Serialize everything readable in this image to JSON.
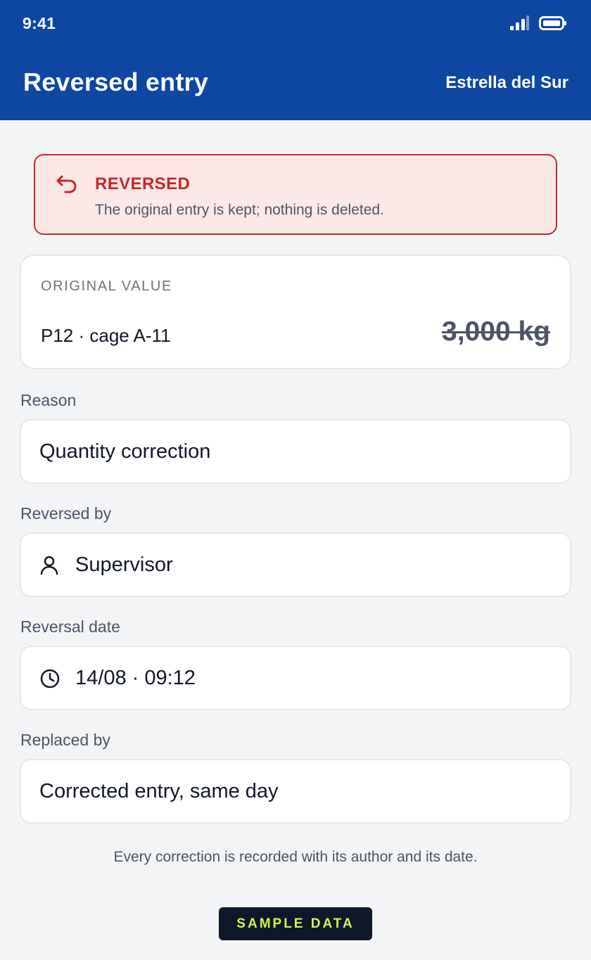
{
  "status_bar": {
    "time": "9:41",
    "icons": [
      "signal-icon",
      "battery-icon"
    ]
  },
  "header": {
    "title": "Reversed entry",
    "organization": "Estrella del Sur",
    "background_color": "#0d47a1"
  },
  "banner": {
    "icon": "undo-icon",
    "title": "REVERSED",
    "text": "The original entry is kept; nothing is deleted.",
    "accent_color": "#c62828"
  },
  "original": {
    "label": "ORIGINAL VALUE",
    "item": "P12 · cage A-11",
    "quantity": "3,000 kg"
  },
  "fields": {
    "reason": {
      "label": "Reason",
      "value": "Quantity correction"
    },
    "reversed_by": {
      "label": "Reversed by",
      "value": "Supervisor",
      "icon": "user-icon"
    },
    "reversal_date": {
      "label": "Reversal date",
      "value": "14/08 · 09:12",
      "icon": "clock-icon"
    },
    "replaced_by": {
      "label": "Replaced by",
      "value": "Corrected entry, same day"
    }
  },
  "footnote": "Every correction is recorded with its author and its date.",
  "badge": "SAMPLE DATA"
}
